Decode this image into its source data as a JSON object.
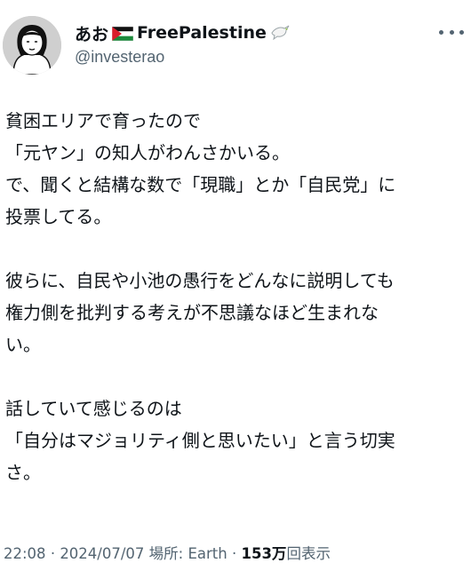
{
  "author": {
    "display_name_prefix": "あお",
    "display_name_main": "FreePalestine",
    "handle": "@investerao",
    "flag_icon": "palestine-flag-icon",
    "emoji_icon": "dove-icon"
  },
  "tweet": {
    "lines": [
      "貧困エリアで育ったので",
      "「元ヤン」の知人がわんさかいる。",
      "で、聞くと結構な数で「現職」とか「自民党」に",
      "投票してる。",
      "",
      "彼らに、自民や小池の愚行をどんなに説明しても",
      "権力側を批判する考えが不思議なほど生まれな",
      "い。",
      "",
      "話していて感じるのは",
      "「自分はマジョリティ側と思いたい」と言う切実",
      "さ。"
    ]
  },
  "meta": {
    "time": "22:08",
    "date": "2024/07/07",
    "location_label": "場所: Earth",
    "separator": "·",
    "views_count": "153万",
    "views_label": "回表示"
  },
  "colors": {
    "text": "#0f1419",
    "secondary": "#536471",
    "flag_red": "#d91e2a",
    "flag_green": "#1d8a3c"
  }
}
